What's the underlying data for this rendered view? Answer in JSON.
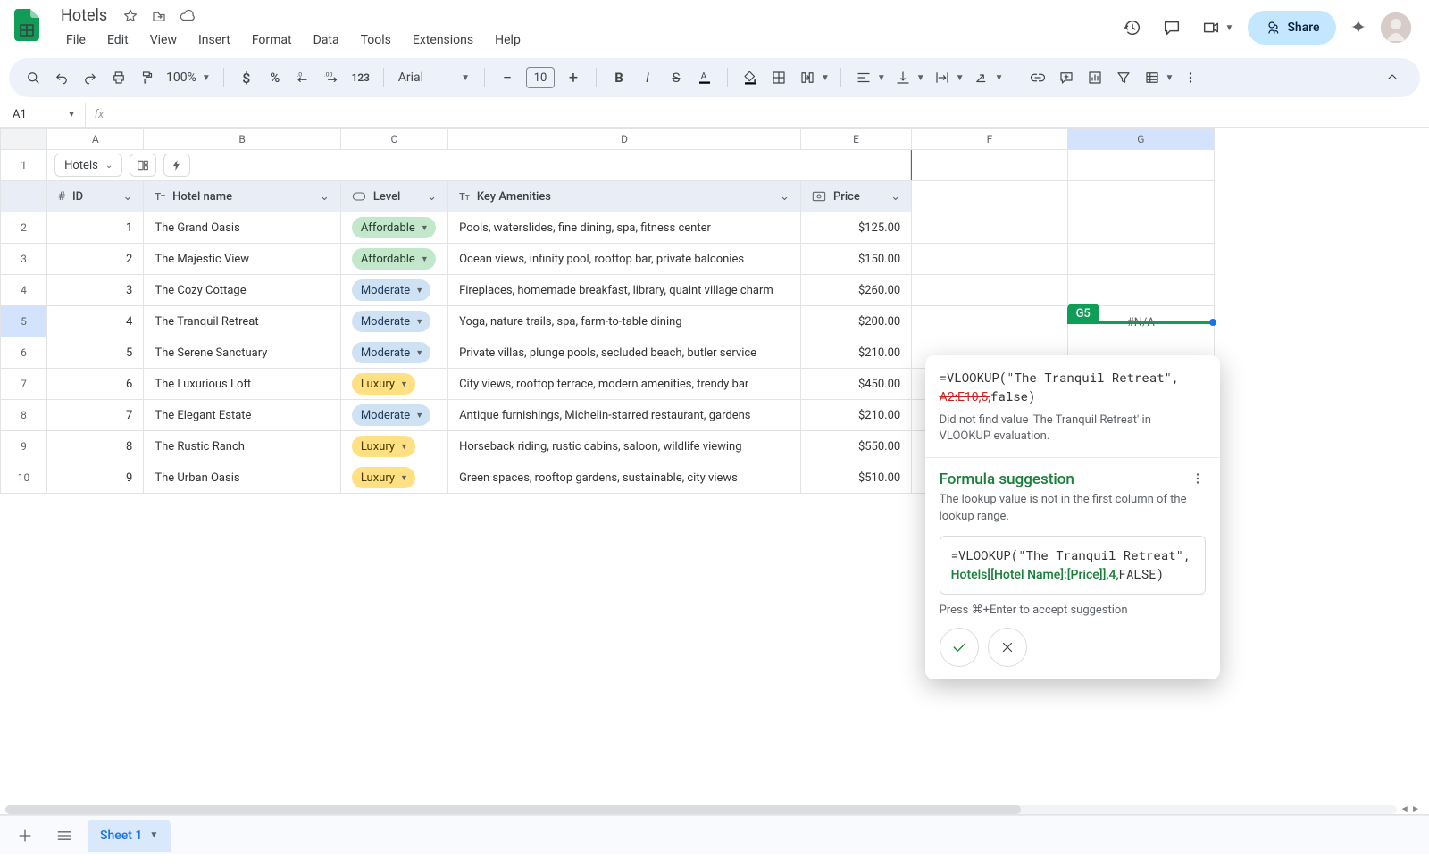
{
  "doc_title": "Hotels",
  "menubar": [
    "File",
    "Edit",
    "View",
    "Insert",
    "Format",
    "Data",
    "Tools",
    "Extensions",
    "Help"
  ],
  "share_label": "Share",
  "zoom": "100%",
  "font_family": "Arial",
  "font_size": "10",
  "namebox": "A1",
  "col_letters": [
    "A",
    "B",
    "C",
    "D",
    "E",
    "F",
    "G"
  ],
  "row_numbers": [
    "1",
    "2",
    "3",
    "4",
    "5",
    "6",
    "7",
    "8",
    "9",
    "10"
  ],
  "table_chip": "Hotels",
  "columns": {
    "id": "ID",
    "hotel": "Hotel name",
    "level": "Level",
    "amenities": "Key Amenities",
    "price": "Price"
  },
  "rows": [
    {
      "id": "1",
      "hotel": "The Grand Oasis",
      "level": "Affordable",
      "amenities": "Pools, waterslides, fine dining, spa, fitness center",
      "price": "$125.00"
    },
    {
      "id": "2",
      "hotel": "The Majestic View",
      "level": "Affordable",
      "amenities": "Ocean views, infinity pool, rooftop bar, private balconies",
      "price": "$150.00"
    },
    {
      "id": "3",
      "hotel": "The Cozy Cottage",
      "level": "Moderate",
      "amenities": "Fireplaces, homemade breakfast, library, quaint village charm",
      "price": "$260.00"
    },
    {
      "id": "4",
      "hotel": "The Tranquil Retreat",
      "level": "Moderate",
      "amenities": "Yoga, nature trails, spa, farm-to-table dining",
      "price": "$200.00"
    },
    {
      "id": "5",
      "hotel": "The Serene Sanctuary",
      "level": "Moderate",
      "amenities": "Private villas, plunge pools, secluded beach, butler service",
      "price": "$210.00"
    },
    {
      "id": "6",
      "hotel": "The Luxurious Loft",
      "level": "Luxury",
      "amenities": "City views, rooftop terrace, modern amenities, trendy bar",
      "price": "$450.00"
    },
    {
      "id": "7",
      "hotel": "The Elegant Estate",
      "level": "Moderate",
      "amenities": "Antique furnishings, Michelin-starred restaurant, gardens",
      "price": "$210.00"
    },
    {
      "id": "8",
      "hotel": "The Rustic Ranch",
      "level": "Luxury",
      "amenities": "Horseback riding, rustic cabins, saloon, wildlife viewing",
      "price": "$550.00"
    },
    {
      "id": "9",
      "hotel": "The Urban Oasis",
      "level": "Luxury",
      "amenities": "Green spaces, rooftop gardens, sustainable, city views",
      "price": "$510.00"
    }
  ],
  "g5": {
    "tag": "G5",
    "value": "#N/A",
    "formula_line1": "=VLOOKUP(\"The Tranquil Retreat\",",
    "formula_strike": "A2:E10,5,",
    "formula_after": "false)",
    "error_desc": "Did not find value 'The Tranquil Retreat' in VLOOKUP evaluation.",
    "suggestion_title": "Formula suggestion",
    "suggestion_sub": "The lookup value is not in the first column of the lookup range.",
    "suggestion_formula_p1": "=VLOOKUP(\"The Tranquil Retreat\",",
    "suggestion_formula_green": "Hotels[[Hotel Name]:[Price]],4,",
    "suggestion_formula_p3": "FALSE)",
    "hint": "Press ⌘+Enter to accept suggestion"
  },
  "sheet_tab": "Sheet 1"
}
